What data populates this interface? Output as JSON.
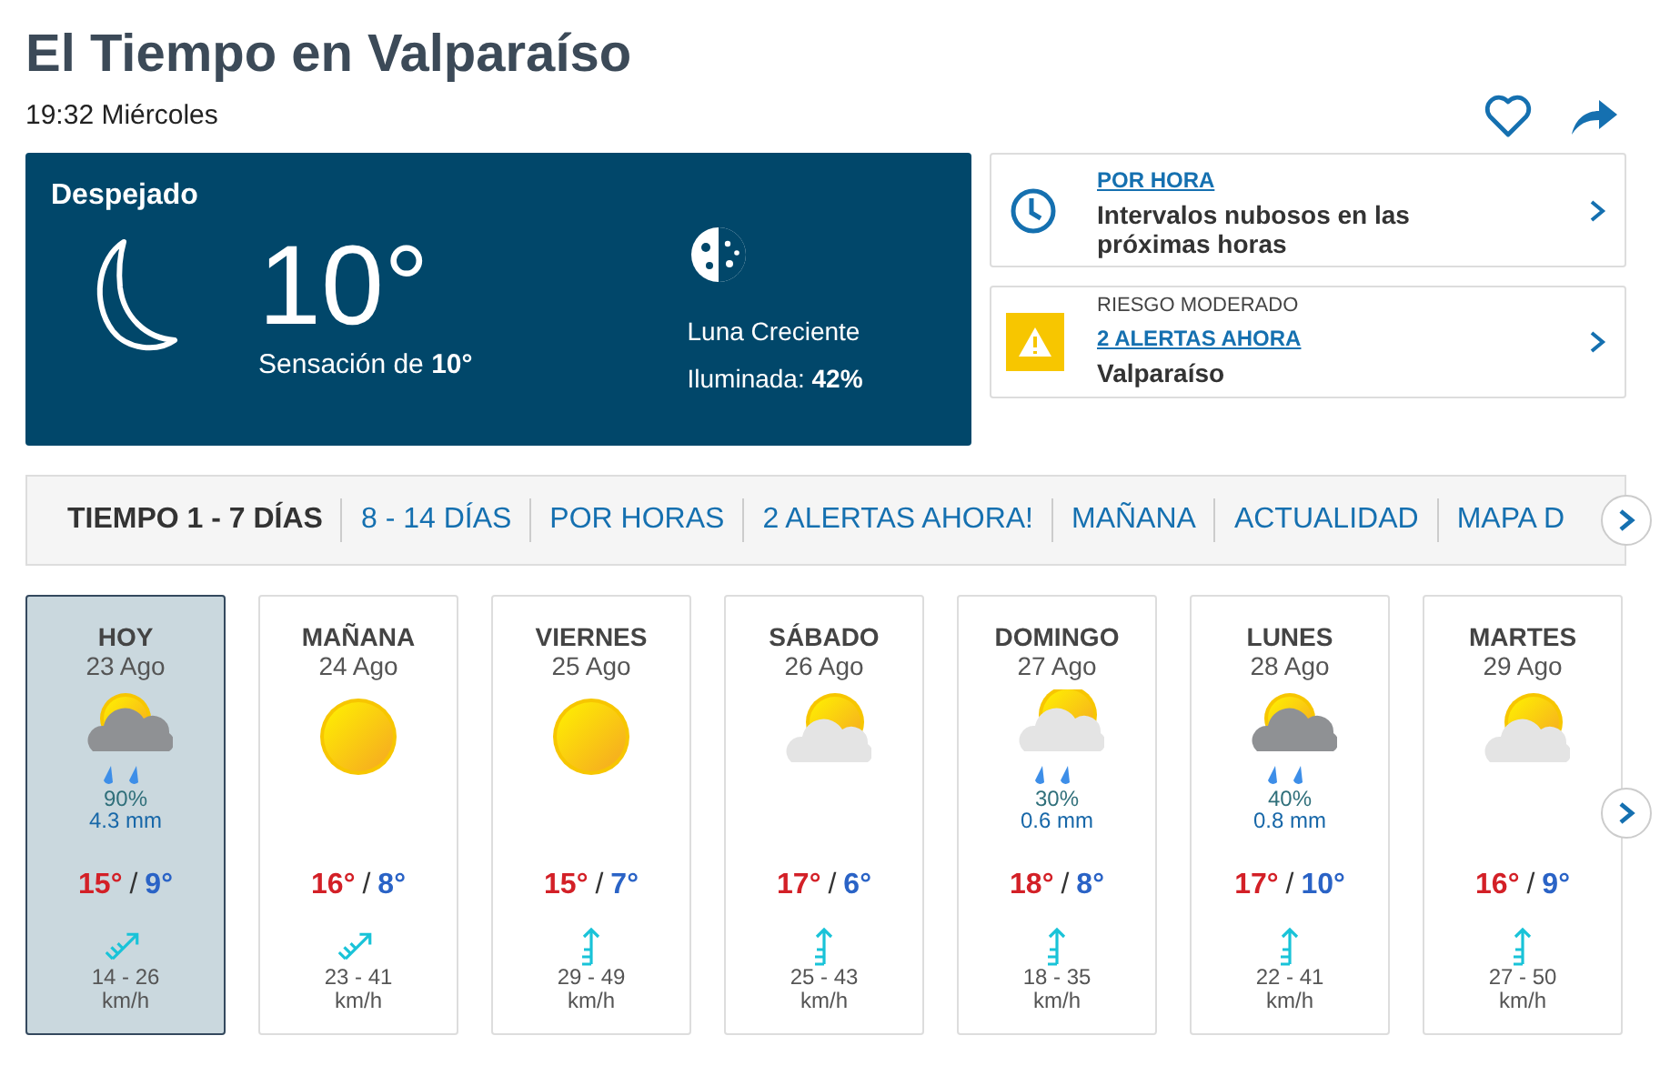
{
  "title": "El Tiempo en Valparaíso",
  "subtitle": "19:32 Miércoles",
  "current": {
    "condition": "Despejado",
    "temperature": "10°",
    "feels_like": "Sensación de **10°**",
    "moon_phase": "Luna Creciente",
    "illumination": "Iluminada: **42%**"
  },
  "hourly_card": {
    "link": "POR HORA",
    "text": "Intervalos nubosos en las próximas horas"
  },
  "alert_card": {
    "risk": "RIESGO MODERADO",
    "link": "2 ALERTAS AHORA",
    "place": "Valparaíso"
  },
  "tabs": [
    {
      "label": "TIEMPO 1 - 7 DÍAS",
      "selected": true
    },
    {
      "label": "8 - 14 DÍAS",
      "selected": false
    },
    {
      "label": "POR HORAS",
      "selected": false
    },
    {
      "label": "2 ALERTAS AHORA!",
      "selected": false
    },
    {
      "label": "MAÑANA",
      "selected": false
    },
    {
      "label": "ACTUALIDAD",
      "selected": false
    },
    {
      "label": "MAPA D",
      "selected": false
    }
  ],
  "days": [
    {
      "name": "HOY",
      "date": "23 Ago",
      "kind": "storm_rain",
      "rain_chance": "90%",
      "rain_amount": "4.3 mm",
      "max": "15°",
      "separator": "/",
      "min": "9°",
      "wind": {
        "kind": "ne",
        "speed": "14 - 26",
        "unit": "km/h"
      },
      "selected": true
    },
    {
      "name": "MAÑANA",
      "date": "24 Ago",
      "kind": "sun",
      "max": "16°",
      "separator": "/",
      "min": "8°",
      "wind": {
        "kind": "ne",
        "speed": "23 - 41",
        "unit": "km/h"
      },
      "selected": false
    },
    {
      "name": "VIERNES",
      "date": "25 Ago",
      "kind": "sun",
      "max": "15°",
      "separator": "/",
      "min": "7°",
      "wind": {
        "kind": "n",
        "speed": "29 - 49",
        "unit": "km/h"
      },
      "selected": false
    },
    {
      "name": "SÁBADO",
      "date": "26 Ago",
      "kind": "sun_cloud",
      "max": "17°",
      "separator": "/",
      "min": "6°",
      "wind": {
        "kind": "n",
        "speed": "25 - 43",
        "unit": "km/h"
      },
      "selected": false
    },
    {
      "name": "DOMINGO",
      "date": "27 Ago",
      "kind": "sun_rain",
      "rain_chance": "30%",
      "rain_amount": "0.6 mm",
      "max": "18°",
      "separator": "/",
      "min": "8°",
      "wind": {
        "kind": "n",
        "speed": "18 - 35",
        "unit": "km/h"
      },
      "selected": false
    },
    {
      "name": "LUNES",
      "date": "28 Ago",
      "kind": "storm_rain",
      "rain_chance": "40%",
      "rain_amount": "0.8 mm",
      "max": "17°",
      "separator": "/",
      "min": "10°",
      "wind": {
        "kind": "n",
        "speed": "22 - 41",
        "unit": "km/h"
      },
      "selected": false
    },
    {
      "name": "MARTES",
      "date": "29 Ago",
      "kind": "sun_cloud",
      "max": "16°",
      "separator": "/",
      "min": "9°",
      "wind": {
        "kind": "n",
        "speed": "27 - 50",
        "unit": "km/h"
      },
      "selected": false
    }
  ]
}
